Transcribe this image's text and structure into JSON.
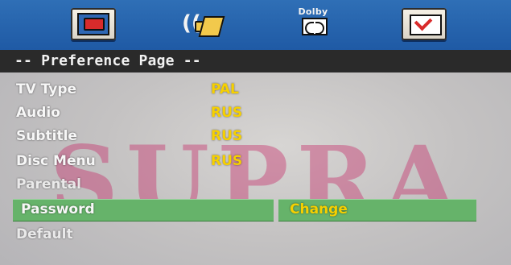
{
  "top_icons": [
    {
      "name": "setup-icon"
    },
    {
      "name": "audio-speaker-icon"
    },
    {
      "name": "dolby-icon",
      "label": "Dolby"
    },
    {
      "name": "preference-check-icon"
    }
  ],
  "page_title": "-- Preference Page --",
  "menu": [
    {
      "label": "TV Type",
      "value": "PAL"
    },
    {
      "label": "Audio",
      "value": "RUS"
    },
    {
      "label": "Subtitle",
      "value": "RUS"
    },
    {
      "label": "Disc Menu",
      "value": "RUS"
    },
    {
      "label": "Parental",
      "value": ""
    },
    {
      "label": "Password",
      "value": ""
    },
    {
      "label": "Default",
      "value": ""
    }
  ],
  "highlighted_option": "Change",
  "watermark_text": "SUPRA",
  "colors": {
    "topbar": "#1f5aa5",
    "title_bar": "#2a2a2a",
    "value_text": "#f6d000",
    "highlight_bar": "#66b36a",
    "watermark": "#c72f6b"
  }
}
